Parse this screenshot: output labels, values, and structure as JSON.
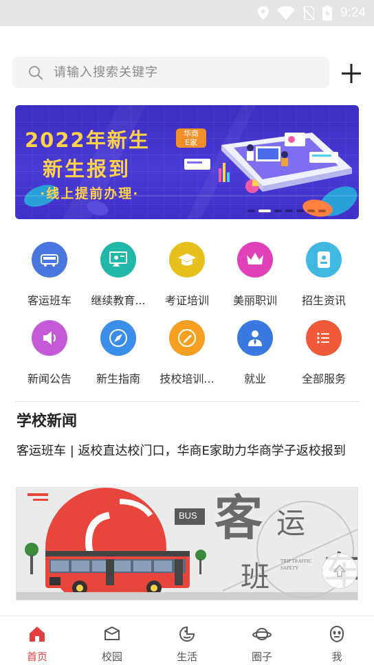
{
  "status_bar": {
    "time": "9:24",
    "icons": [
      "location-icon",
      "wifi-icon",
      "no-sim-icon",
      "battery-icon"
    ]
  },
  "search": {
    "placeholder": "请输入搜索关键字",
    "add_icon": "plus-icon"
  },
  "banner": {
    "line1": "2022年新生",
    "line2": "新生报到",
    "line3": "·线上提前办理·",
    "badge": "华商\nE家",
    "slide_count": 7,
    "active_slide": 2
  },
  "services": [
    {
      "label": "客运班车",
      "icon": "bus-icon",
      "color": "#4a76e0"
    },
    {
      "label": "继续教育...",
      "icon": "teacher-board-icon",
      "color": "#22b8a8"
    },
    {
      "label": "考证培训",
      "icon": "graduation-cap-icon",
      "color": "#e6c01c"
    },
    {
      "label": "美丽职训",
      "icon": "crown-icon",
      "color": "#e040b8"
    },
    {
      "label": "招生资讯",
      "icon": "id-card-icon",
      "color": "#40b8e0"
    },
    {
      "label": "新闻公告",
      "icon": "speaker-icon",
      "color": "#c45ad8"
    },
    {
      "label": "新生指南",
      "icon": "compass-icon",
      "color": "#3a8ee8"
    },
    {
      "label": "技校培训...",
      "icon": "pen-circle-icon",
      "color": "#f5a020"
    },
    {
      "label": "就业",
      "icon": "person-tie-icon",
      "color": "#3a7ae0"
    },
    {
      "label": "全部服务",
      "icon": "list-icon",
      "color": "#f05a3a"
    }
  ],
  "news": {
    "section_title": "学校新闻",
    "headline": "客运班车 | 返校直达校门口，华商E家助力华商学子返校报到",
    "image": {
      "bus_tag": "BUS",
      "big_chars": [
        "客",
        "运",
        "班",
        "车"
      ],
      "caption": "TRIP TRAFFIC SAFETY"
    }
  },
  "tabs": [
    {
      "label": "首页",
      "icon": "home-icon",
      "active": true
    },
    {
      "label": "校园",
      "icon": "campus-box-icon",
      "active": false
    },
    {
      "label": "生活",
      "icon": "life-pacman-icon",
      "active": false
    },
    {
      "label": "圈子",
      "icon": "planet-icon",
      "active": false
    },
    {
      "label": "我",
      "icon": "profile-face-icon",
      "active": false
    }
  ],
  "colors": {
    "accent": "#e53e3e",
    "banner_bg": "#4030c8",
    "banner_text": "#ffd24a"
  }
}
